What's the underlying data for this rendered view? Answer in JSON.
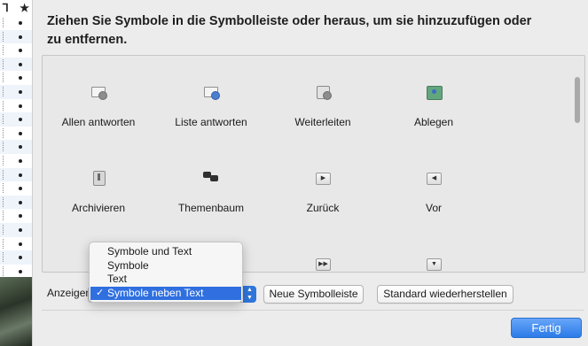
{
  "background_window": {
    "header_icons": [
      "thread-icon",
      "star-icon"
    ],
    "row_count": 19
  },
  "sheet": {
    "title": "Ziehen Sie Symbole in die Symbolleiste oder heraus, um sie hinzuzufügen oder zu entfernen.",
    "tools": [
      {
        "label": "Allen antworten",
        "icon": "reply-all-icon"
      },
      {
        "label": "Liste antworten",
        "icon": "reply-list-icon"
      },
      {
        "label": "Weiterleiten",
        "icon": "forward-icon"
      },
      {
        "label": "Ablegen",
        "icon": "file-icon"
      },
      {
        "label": "Archivieren",
        "icon": "archive-icon"
      },
      {
        "label": "Themenbaum",
        "icon": "thread-icon"
      },
      {
        "label": "Zurück",
        "icon": "back-icon"
      },
      {
        "label": "Vor",
        "icon": "forward-arrow-icon"
      },
      {
        "label": "",
        "icon": "fast-forward-icon"
      },
      {
        "label": "",
        "icon": "dropdown-icon"
      }
    ],
    "show_label": "Anzeigen:",
    "show_menu": {
      "options": [
        "Symbole und Text",
        "Symbole",
        "Text",
        "Symbole neben Text"
      ],
      "selected": "Symbole neben Text",
      "check_glyph": "✓"
    },
    "buttons": {
      "new_toolbar": "Neue Symbolleiste",
      "restore_default": "Standard wiederherstellen",
      "done": "Fertig"
    }
  },
  "colors": {
    "accent": "#2f6fe0",
    "done_button": "#2b7be8"
  }
}
